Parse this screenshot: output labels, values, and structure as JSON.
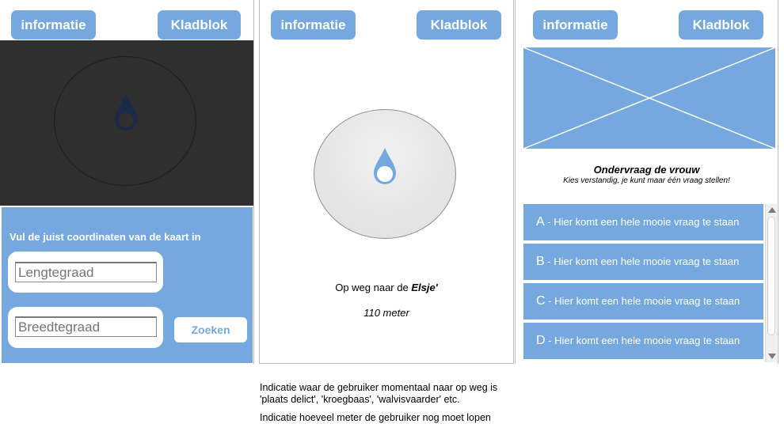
{
  "panel1": {
    "info_label": "informatie",
    "notepad_label": "Kladblok",
    "coord_title": "Vul de juist coordinaten van de kaart in",
    "longitude_placeholder": "Lengtegraad",
    "latitude_placeholder": "Breedtegraad",
    "search_label": "Zoeken"
  },
  "panel2": {
    "info_label": "informatie",
    "notepad_label": "Kladblok",
    "dest_prefix": "Op weg naar de ",
    "dest_name": "Elsje'",
    "distance": "110 meter"
  },
  "panel3": {
    "info_label": "informatie",
    "notepad_label": "Kladblok",
    "question_title": "Ondervraag de vrouw",
    "question_subtitle": "Kies verstandig, je kunt maar één vraag stellen!",
    "questions": [
      {
        "letter": "A",
        "text": " - Hier komt een hele mooie vraag te staan"
      },
      {
        "letter": "B",
        "text": " - Hier komt een hele mooie vraag te staan"
      },
      {
        "letter": "C",
        "text": " - Hier komt een hele mooie vraag te staan"
      },
      {
        "letter": "D",
        "text": " - Hier komt een hele mooie vraag te staan"
      }
    ]
  },
  "annotations": {
    "line1": "Indicatie waar de gebruiker momentaal naar op weg is",
    "line2": "'plaats delict', 'kroegbaas', 'walvisvaarder' etc.",
    "line3": "Indicatie hoeveel meter de gebruiker nog moet lopen"
  },
  "colors": {
    "accent": "#74a8de",
    "map_dark": "#2f2f2f",
    "compass_marker": "#1b2a4a",
    "compass_marker_light": "#74a8de"
  },
  "icons": {
    "compass_marker": "location-drop-icon",
    "image_placeholder": "image-placeholder-icon"
  }
}
